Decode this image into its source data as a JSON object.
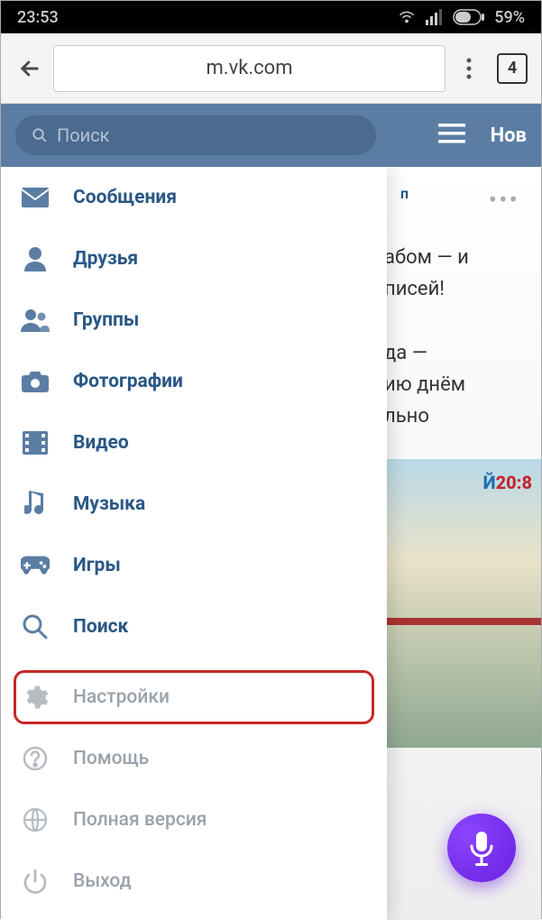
{
  "status": {
    "time": "23:53",
    "battery": "59%"
  },
  "browser": {
    "url": "m.vk.com",
    "tab_count": "4"
  },
  "vk_header": {
    "search_placeholder": "Поиск",
    "title": "Нов"
  },
  "menu": {
    "items": [
      {
        "label": "Сообщения"
      },
      {
        "label": "Друзья"
      },
      {
        "label": "Группы"
      },
      {
        "label": "Фотографии"
      },
      {
        "label": "Видео"
      },
      {
        "label": "Музыка"
      },
      {
        "label": "Игры"
      },
      {
        "label": "Поиск"
      }
    ],
    "secondary": [
      {
        "label": "Настройки"
      },
      {
        "label": "Помощь"
      },
      {
        "label": "Полная версия"
      },
      {
        "label": "Выход"
      }
    ]
  },
  "feed": {
    "snippets": [
      "п",
      "абом — и",
      "писей!",
      "да —",
      "ию днём",
      "льно"
    ],
    "year1": "Й",
    "year2": "20:8"
  },
  "colors": {
    "vk_blue": "#5b7da4",
    "accent_red": "#c62828",
    "fab_purple": "#6a1fe0"
  }
}
